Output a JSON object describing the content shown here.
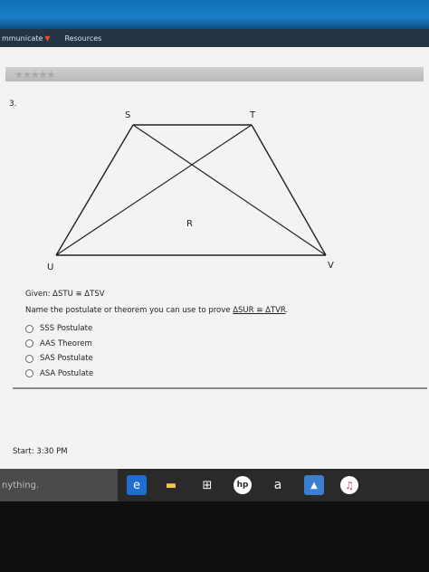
{
  "nav": {
    "items": [
      "mmunicate",
      "Resources"
    ]
  },
  "rating": {
    "stars": "★★★★★"
  },
  "question": {
    "number": "3.",
    "labels": {
      "S": "S",
      "T": "T",
      "R": "R",
      "U": "U",
      "V": "V"
    },
    "given": "Given: ΔSTU ≅ ΔTSV",
    "prompt": "Name the postulate or theorem you can use to prove ",
    "prompt_tail": "ΔSUR ≅ ΔTVR",
    "prompt_end": ".",
    "options": [
      "SSS Postulate",
      "AAS Theorem",
      "SAS Postulate",
      "ASA Postulate"
    ]
  },
  "start_time": "Start: 3:30 PM",
  "taskbar": {
    "search_text": "nything.",
    "icons": [
      "edge-icon",
      "file-explorer-icon",
      "store-icon",
      "hp-icon",
      "amazon-icon",
      "photos-icon",
      "itunes-icon"
    ]
  }
}
